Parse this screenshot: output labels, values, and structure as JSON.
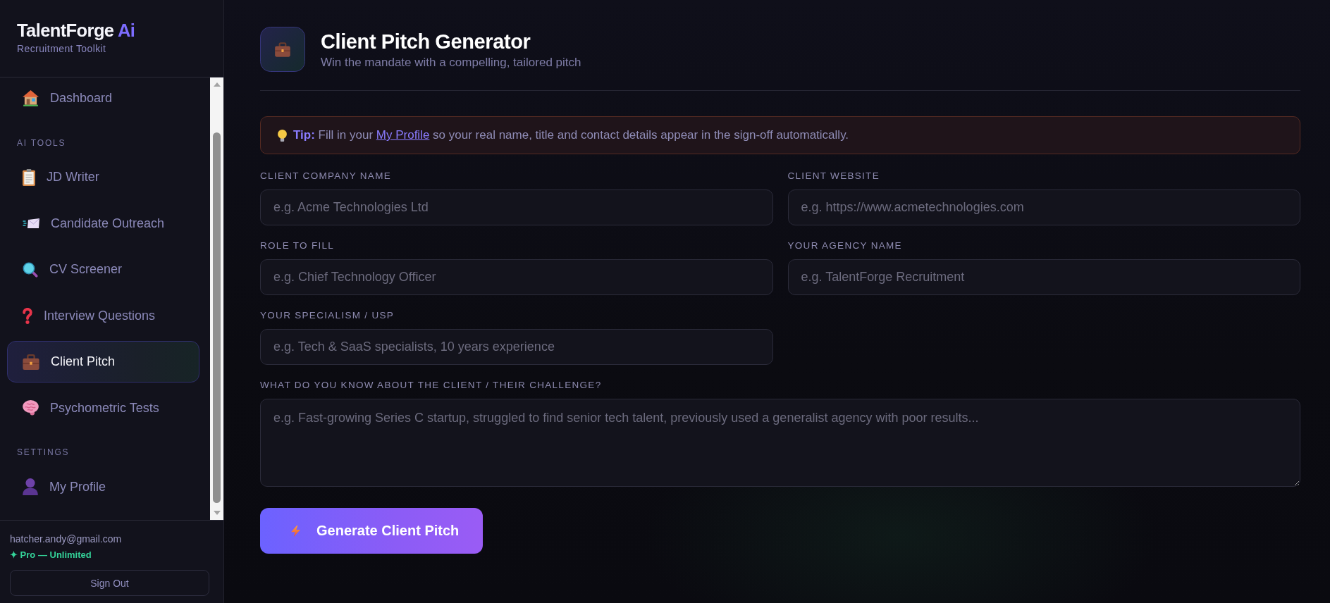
{
  "sidebar": {
    "brand": {
      "name": "TalentForge",
      "accent": "Ai",
      "tagline": "Recruitment Toolkit"
    },
    "nav_sections": [
      {
        "items": [
          {
            "label": "Dashboard",
            "selected": false
          }
        ]
      },
      {
        "heading": "AI TOOLS",
        "items": [
          {
            "label": "JD Writer",
            "selected": false
          },
          {
            "label": "Candidate Outreach",
            "selected": false
          },
          {
            "label": "CV Screener",
            "selected": false
          },
          {
            "label": "Interview Questions",
            "selected": false
          },
          {
            "label": "Client Pitch",
            "selected": true
          },
          {
            "label": "Psychometric Tests",
            "selected": false
          }
        ]
      },
      {
        "heading": "SETTINGS",
        "items": [
          {
            "label": "My Profile",
            "selected": false
          }
        ]
      }
    ],
    "account": {
      "email": "hatcher.andy@gmail.com",
      "plan": "✦ Pro — Unlimited",
      "sign_out": "Sign Out"
    }
  },
  "page_header": {
    "title": "Client Pitch Generator",
    "subtitle": "Win the mandate with a compelling, tailored pitch"
  },
  "tip": {
    "lead": "Tip:",
    "before": "Fill in your",
    "link": "My Profile",
    "after": "so your real name, title and contact details appear in the sign-off automatically."
  },
  "form": {
    "fields": [
      {
        "kind": "input",
        "label": "CLIENT COMPANY NAME",
        "placeholder": "e.g. Acme Technologies Ltd"
      },
      {
        "kind": "input",
        "label": "CLIENT WEBSITE",
        "placeholder": "e.g. https://www.acmetechnologies.com"
      },
      {
        "kind": "input",
        "label": "ROLE TO FILL",
        "placeholder": "e.g. Chief Technology Officer"
      },
      {
        "kind": "input",
        "label": "YOUR AGENCY NAME",
        "placeholder": "e.g. TalentForge Recruitment"
      },
      {
        "kind": "input",
        "label": "YOUR SPECIALISM / USP",
        "placeholder": "e.g. Tech & SaaS specialists, 10 years experience"
      },
      {
        "kind": "textarea",
        "label": "WHAT DO YOU KNOW ABOUT THE CLIENT / THEIR CHALLENGE?",
        "placeholder": "e.g. Fast-growing Series C startup, struggled to find senior tech talent, previously used a generalist agency with poor results..."
      }
    ],
    "submit": "Generate Client Pitch"
  }
}
